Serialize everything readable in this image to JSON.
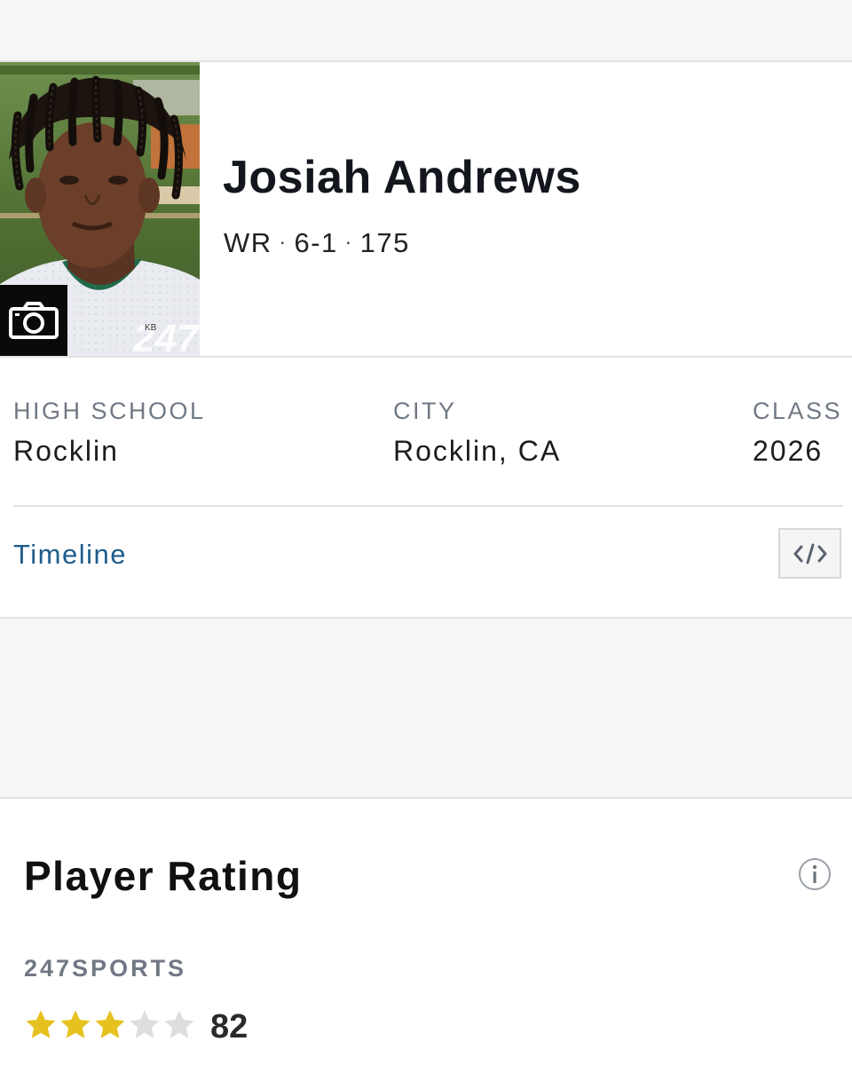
{
  "player": {
    "name": "Josiah Andrews",
    "position": "WR",
    "height": "6-1",
    "weight": "175",
    "photo_watermark": "247",
    "photo_initials": "KB"
  },
  "info": {
    "high_school_label": "HIGH SCHOOL",
    "high_school_value": "Rocklin",
    "city_label": "CITY",
    "city_value": "Rocklin, CA",
    "class_label": "CLASS",
    "class_value": "2026"
  },
  "links": {
    "timeline": "Timeline"
  },
  "icons": {
    "camera": "camera-icon",
    "embed": "code-embed-icon",
    "info": "info-icon",
    "star": "star-icon"
  },
  "rating": {
    "title": "Player Rating",
    "source": "247SPORTS",
    "stars_filled": 3,
    "stars_total": 5,
    "score": "82"
  },
  "colors": {
    "star_filled": "#e6c220",
    "star_empty": "#dedede",
    "link": "#1f5d8c"
  }
}
